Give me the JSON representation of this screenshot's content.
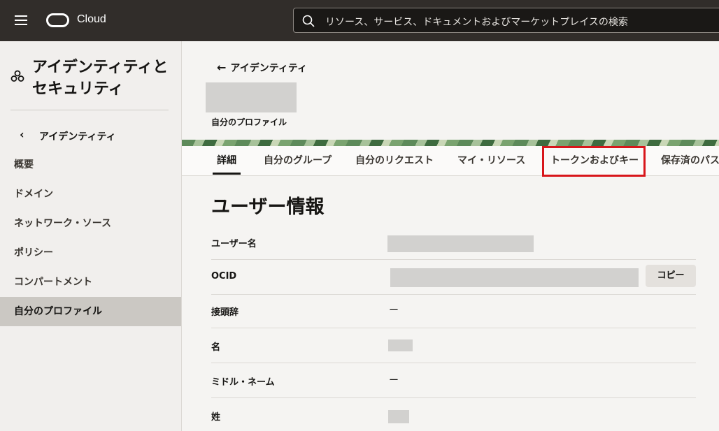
{
  "topbar": {
    "brand": "Cloud",
    "search_placeholder": "リソース、サービス、ドキュメントおよびマーケットプレイスの検索"
  },
  "sidebar": {
    "title": "アイデンティティとセキュリティ",
    "back_label": "アイデンティティ",
    "items": [
      {
        "label": "概要"
      },
      {
        "label": "ドメイン"
      },
      {
        "label": "ネットワーク・ソース"
      },
      {
        "label": "ポリシー"
      },
      {
        "label": "コンパートメント"
      },
      {
        "label": "自分のプロファイル",
        "active": true
      }
    ]
  },
  "header": {
    "back_link": "アイデンティティ",
    "profile_caption": "自分のプロファイル"
  },
  "tabs": [
    {
      "label": "詳細",
      "active": true
    },
    {
      "label": "自分のグループ"
    },
    {
      "label": "自分のリクエスト"
    },
    {
      "label": "マイ・リソース"
    },
    {
      "label": "トークンおよびキー",
      "highlighted": true
    },
    {
      "label": "保存済のパス"
    }
  ],
  "main": {
    "section_title": "ユーザー情報",
    "rows": [
      {
        "label": "ユーザー名",
        "value": ""
      },
      {
        "label": "OCID",
        "value": ""
      },
      {
        "label": "接頭辞",
        "value": "ー"
      },
      {
        "label": "名",
        "value": ""
      },
      {
        "label": "ミドル・ネーム",
        "value": "ー"
      },
      {
        "label": "姓",
        "value": ""
      }
    ],
    "copy_button": "コピー"
  },
  "colors": {
    "topbar": "#312d2a",
    "highlight": "#d8161b",
    "active_sidebar": "#cbc8c3"
  }
}
